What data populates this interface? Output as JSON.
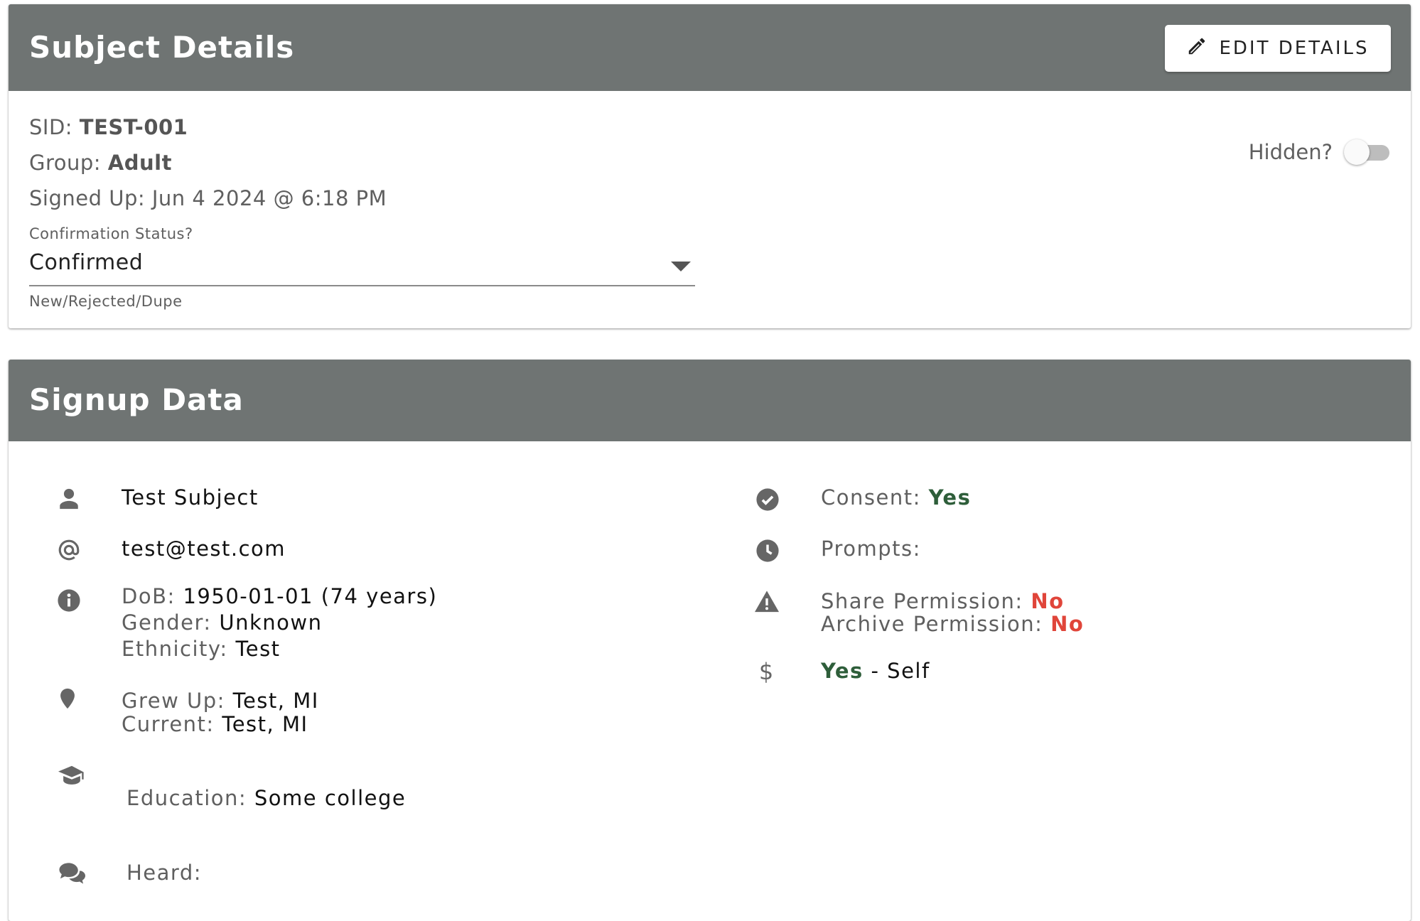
{
  "subject_details": {
    "title": "Subject Details",
    "edit_label": "EDIT DETAILS",
    "sid_label": "SID: ",
    "sid_value": "TEST-001",
    "group_label": "Group: ",
    "group_value": "Adult",
    "signed_up_label": "Signed Up: ",
    "signed_up_value": "Jun 4 2024 @ 6:18 PM",
    "hidden_label": "Hidden?",
    "confirmation": {
      "label": "Confirmation Status?",
      "value": "Confirmed",
      "hint": "New/Rejected/Dupe"
    }
  },
  "signup_data": {
    "title": "Signup Data",
    "name": "Test Subject",
    "email": "test@test.com",
    "dob_label": "DoB: ",
    "dob_value": "1950-01-01 (74 years)",
    "gender_label": "Gender: ",
    "gender_value": "Unknown",
    "ethnicity_label": "Ethnicity: ",
    "ethnicity_value": "Test",
    "grew_up_label": "Grew Up: ",
    "grew_up_value": "Test, MI",
    "current_label": "Current: ",
    "current_value": "Test, MI",
    "education_label": "Education: ",
    "education_value": "Some college",
    "heard_label": "Heard:",
    "consent_label": "Consent: ",
    "consent_value": "Yes",
    "prompts_label": "Prompts:",
    "share_label": "Share Permission: ",
    "share_value": "No",
    "archive_label": "Archive Permission: ",
    "archive_value": "No",
    "payment_value": "Yes",
    "payment_suffix": " - Self"
  },
  "icons": {
    "edit": "pencil-icon",
    "name": "person-icon",
    "email": "at-icon",
    "demographics": "info-icon",
    "location": "map-marker-icon",
    "education": "graduation-cap-icon",
    "heard": "comments-icon",
    "consent": "check-circle-icon",
    "prompts": "clock-icon",
    "permissions": "warning-icon",
    "payment": "dollar-icon"
  },
  "colors": {
    "header_bg": "#6f7473",
    "positive": "#2e5e3a",
    "negative": "#e0453a",
    "toggle_track": "#bdbdbd"
  }
}
